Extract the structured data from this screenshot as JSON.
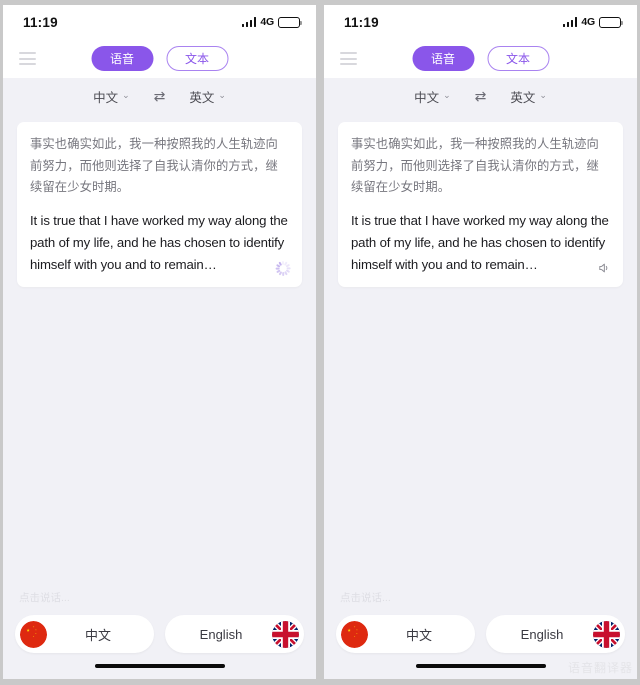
{
  "app": {
    "accent_color": "#8a56ea",
    "accent_light": "#a983f0",
    "screen_bg": "#f1f1f6",
    "outer_bg": "#c9c9c9"
  },
  "status_bar": {
    "time": "11:19",
    "network": "4G",
    "signal_icon": "signal-bars-icon",
    "battery_icon": "battery-full-icon"
  },
  "header": {
    "menu_icon": "hamburger-menu-icon",
    "modes": [
      {
        "label": "语音",
        "selected": true
      },
      {
        "label": "文本",
        "selected": false
      }
    ]
  },
  "lang_bar": {
    "source": "中文",
    "target": "英文",
    "caret": "⌄",
    "swap_icon": "⇄"
  },
  "bubble": {
    "source_text": "事实也确实如此，我一种按照我的人生轨迹向前努力，而他则选择了自我认清你的方式，继续留在少女时期。",
    "target_text": "It is true that I have worked my way along the path of my life, and he has chosen to identify himself with you and to remain…"
  },
  "panels": [
    {
      "action_icon": "loading-spinner-icon"
    },
    {
      "action_icon": "speaker-icon",
      "action_glyph": "◁)"
    }
  ],
  "footer": {
    "speak_hint": "点击说话...",
    "buttons": [
      {
        "label": "中文",
        "flag": "china-flag-icon"
      },
      {
        "label": "English",
        "flag": "uk-flag-icon"
      }
    ]
  },
  "watermark": {
    "text": "语音翻译器"
  }
}
